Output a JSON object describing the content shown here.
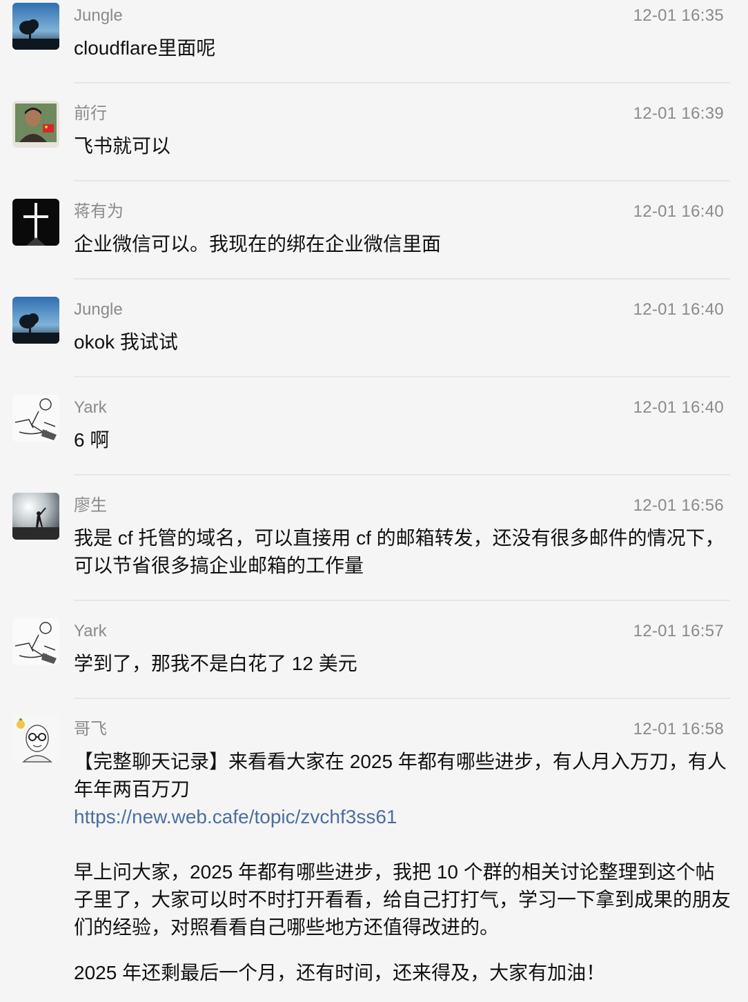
{
  "messages": [
    {
      "sender": "Jungle",
      "time": "12-01 16:35",
      "avatar_icon": "tree-sunset-avatar-icon",
      "lines": [
        "cloudflare里面呢"
      ]
    },
    {
      "sender": "前行",
      "time": "12-01 16:39",
      "avatar_icon": "person-photo-avatar-icon",
      "lines": [
        "飞书就可以"
      ]
    },
    {
      "sender": "蒋有为",
      "time": "12-01 16:40",
      "avatar_icon": "light-cross-avatar-icon",
      "lines": [
        "企业微信可以。我现在的绑在企业微信里面"
      ]
    },
    {
      "sender": "Jungle",
      "time": "12-01 16:40",
      "avatar_icon": "tree-sunset-avatar-icon",
      "lines": [
        "okok 我试试"
      ]
    },
    {
      "sender": "Yark",
      "time": "12-01 16:40",
      "avatar_icon": "sketch-drawing-avatar-icon",
      "lines": [
        "6 啊"
      ]
    },
    {
      "sender": "廖生",
      "time": "12-01 16:56",
      "avatar_icon": "silhouette-photo-avatar-icon",
      "lines": [
        "我是 cf 托管的域名，可以直接用 cf 的邮箱转发，还没有很多邮件的情况下，",
        "可以节省很多搞企业邮箱的工作量"
      ]
    },
    {
      "sender": "Yark",
      "time": "12-01 16:57",
      "avatar_icon": "sketch-drawing-avatar-icon",
      "lines": [
        "学到了，那我不是白花了 12 美元"
      ]
    },
    {
      "sender": "哥飞",
      "time": "12-01 16:58",
      "avatar_icon": "cartoon-glasses-avatar-icon",
      "lines": [
        "【完整聊天记录】来看看大家在 2025 年都有哪些进步，有人月入万刀，有人",
        "年年两百万刀"
      ],
      "link": "https://new.web.cafe/topic/zvchf3ss61",
      "paragraph2": [
        "早上问大家，2025 年都有哪些进步，我把 10 个群的相关讨论整理到这个帖",
        "子里了，大家可以时不时打开看看，给自己打打气，学习一下拿到成果的朋友",
        "们的经验，对照看看自己哪些地方还值得改进的。"
      ],
      "paragraph3": [
        "2025 年还剩最后一个月，还有时间，还来得及，大家有加油！"
      ]
    }
  ],
  "colors": {
    "background": "#f5f5f5",
    "meta_text": "#8a8a8a",
    "link": "#4a6fa0",
    "divider": "#e6e6e6"
  }
}
